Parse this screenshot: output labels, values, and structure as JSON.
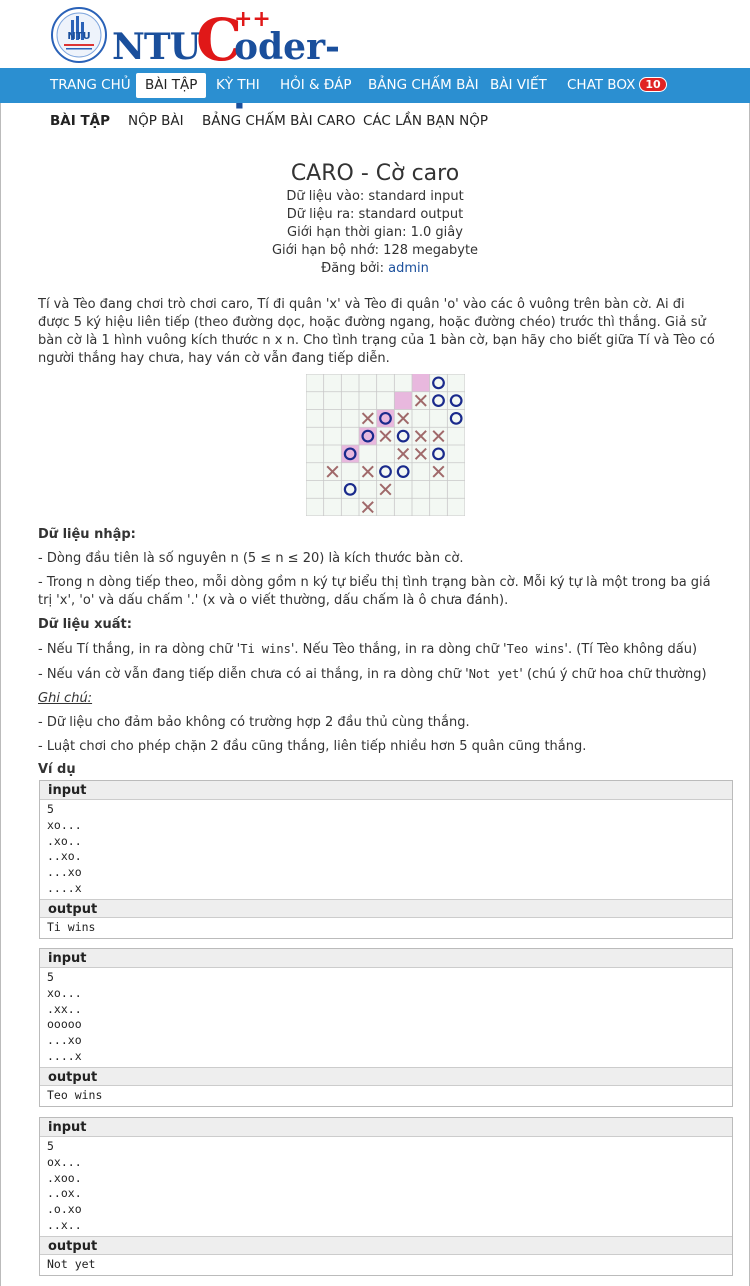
{
  "logo": {
    "ntu": "NTU",
    "c": "C",
    "plus": "++",
    "oder": "oder-β",
    "seal": "NTU"
  },
  "nav": {
    "items": [
      "TRANG CHỦ",
      "BÀI TẬP",
      "KỲ THI",
      "HỎI & ĐÁP",
      "BẢNG CHẤM BÀI",
      "BÀI VIẾT",
      "CHAT BOX"
    ],
    "chat_badge": "10",
    "active": "BÀI TẬP"
  },
  "subnav": {
    "items": [
      "BÀI TẬP",
      "NỘP BÀI",
      "BẢNG CHẤM BÀI CARO",
      "CÁC LẦN BẠN NỘP"
    ]
  },
  "problem": {
    "title": "CARO - Cờ caro",
    "input": "Dữ liệu vào: standard input",
    "output": "Dữ liệu ra: standard output",
    "time": "Giới hạn thời gian: 1.0 giây",
    "memory": "Giới hạn bộ nhớ: 128 megabyte",
    "author_label": "Đăng bởi: ",
    "author": "admin"
  },
  "statement": "Tí và Tèo đang chơi trò chơi caro, Tí đi quân 'x' và Tèo đi quân 'o' vào các ô vuông trên bàn cờ. Ai đi được 5 ký hiệu liên tiếp (theo đường dọc, hoặc đường ngang, hoặc đường chéo) trước thì thắng. Giả sử bàn cờ là 1 hình vuông kích thước n x n. Cho tình trạng của 1 bàn cờ, bạn hãy cho biết giữa Tí và Tèo có người thắng hay chưa, hay ván cờ vẫn đang tiếp diễn.",
  "board": {
    "rows": [
      ".......o.",
      "......xoo",
      "...xox..o",
      "...oxoxx.",
      "..o..xxo.",
      ".x.xoo.x.",
      "..o.x....",
      "...x....."
    ],
    "highlight": [
      [
        0,
        6
      ],
      [
        1,
        5
      ],
      [
        2,
        4
      ],
      [
        3,
        3
      ],
      [
        4,
        2
      ]
    ],
    "colors": {
      "x": "#a0696a",
      "o": "#1a2a8c",
      "highlight": "#e8b8de",
      "grid": "#c8c8c8",
      "bg": "#f3f8f3"
    }
  },
  "input_section": {
    "heading": "Dữ liệu nhập:",
    "line1": "- Dòng đầu tiên là số nguyên n (5 ≤ n ≤ 20) là kích thước bàn cờ.",
    "line2": "- Trong n dòng tiếp theo, mỗi dòng gồm n ký tự biểu thị tình trạng bàn cờ. Mỗi ký tự là một trong ba giá trị 'x', 'o' và dấu chấm '.' (x và o viết thường, dấu chấm là ô chưa đánh)."
  },
  "output_section": {
    "heading": "Dữ liệu xuất:",
    "line1_a": "-  Nếu Tí thắng, in ra dòng chữ '",
    "line1_code1": "Ti wins",
    "line1_b": "'. Nếu Tèo thắng, in ra dòng chữ '",
    "line1_code2": "Teo wins",
    "line1_c": "'. (Tí Tèo không dấu)",
    "line2_a": "- Nếu ván cờ vẫn đang tiếp diễn chưa có ai thắng, in ra dòng chữ '",
    "line2_code": "Not yet",
    "line2_b": "' (chú ý chữ hoa chữ thường)"
  },
  "notes": {
    "heading": "Ghi chú:",
    "line1": "- Dữ liệu cho đảm bảo không có trường hợp 2 đầu thủ cùng thắng.",
    "line2": "- Luật chơi cho phép chặn 2 đầu cũng thắng, liên tiếp nhiều hơn 5 quân cũng thắng."
  },
  "examples": {
    "heading": "Ví dụ",
    "input_label": "input",
    "output_label": "output",
    "items": [
      {
        "input": "5\nxo...\n.xo..\n..xo.\n...xo\n....x",
        "output": "Ti wins"
      },
      {
        "input": "5\nxo...\n.xx..\nooooo\n...xo\n....x",
        "output": "Teo wins"
      },
      {
        "input": "5\nox...\n.xoo.\n..ox.\n.o.xo\n..x..",
        "output": "Not yet"
      }
    ]
  }
}
